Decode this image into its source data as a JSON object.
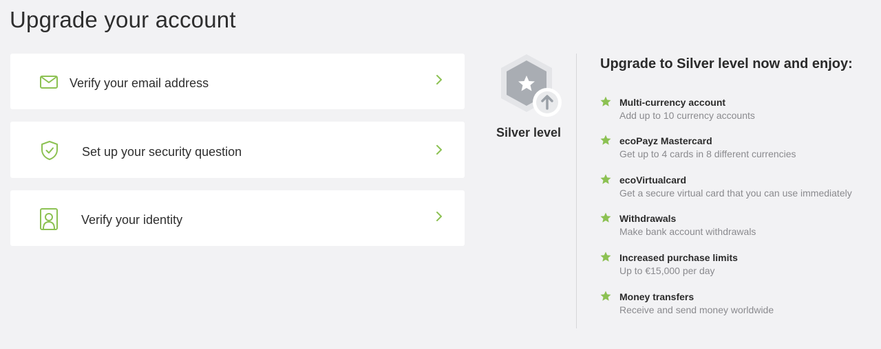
{
  "page": {
    "title": "Upgrade your account"
  },
  "steps": [
    {
      "label": "Verify your email address",
      "icon": "envelope-icon"
    },
    {
      "label": "Set up your security question",
      "icon": "shield-check-icon"
    },
    {
      "label": "Verify your identity",
      "icon": "id-card-icon"
    }
  ],
  "level": {
    "name": "Silver level",
    "icon": "silver-hexagon-star-icon"
  },
  "benefits": {
    "title": "Upgrade to Silver level now and enjoy:",
    "items": [
      {
        "title": "Multi-currency account",
        "desc": "Add up to 10 currency accounts"
      },
      {
        "title": "ecoPayz Mastercard",
        "desc": "Get up to 4 cards in 8 different currencies"
      },
      {
        "title": "ecoVirtualcard",
        "desc": "Get a secure virtual card that you can use immediately"
      },
      {
        "title": "Withdrawals",
        "desc": "Make bank account withdrawals"
      },
      {
        "title": "Increased purchase limits",
        "desc": "Up to €15,000 per day"
      },
      {
        "title": "Money transfers",
        "desc": "Receive and send money worldwide"
      }
    ]
  },
  "colors": {
    "accent": "#8cc152",
    "background": "#f2f2f4",
    "card": "#ffffff",
    "badge": "#a9adb3"
  }
}
